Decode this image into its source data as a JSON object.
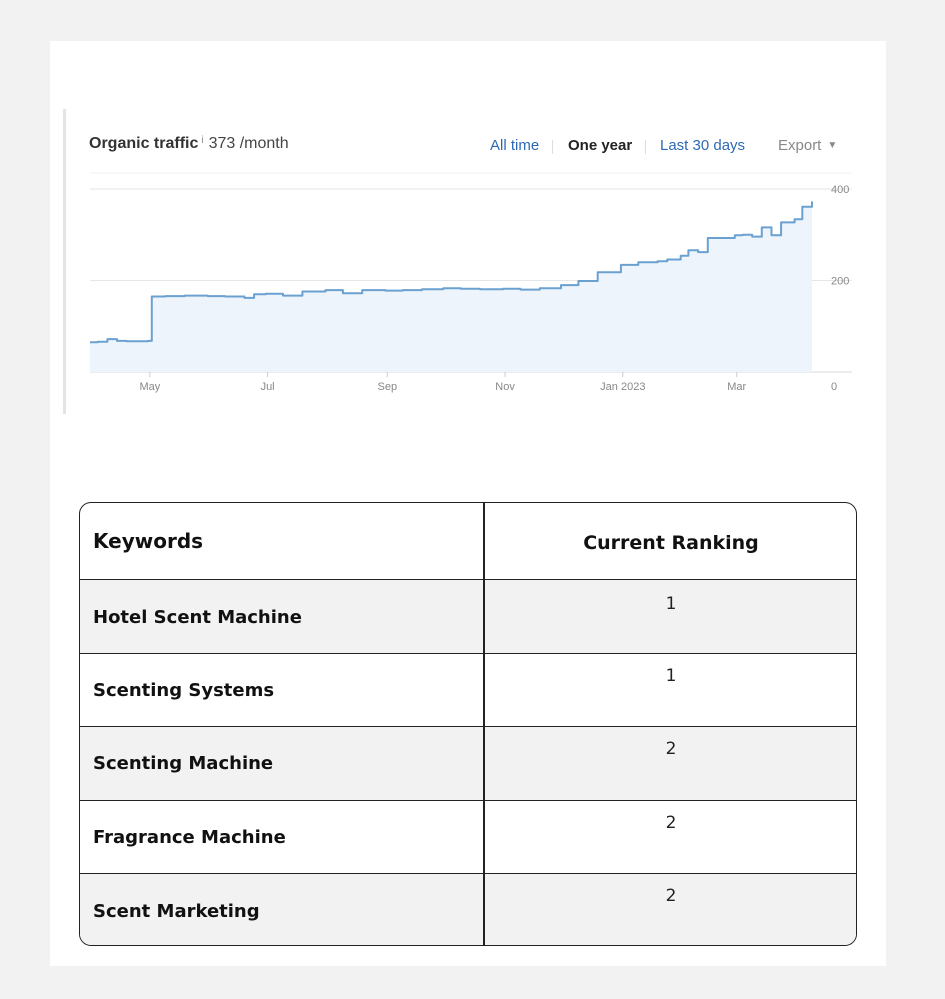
{
  "header": {
    "title": "Organic traffic",
    "info_symbol": "i",
    "value": "373 /month"
  },
  "controls": {
    "ranges": [
      "All time",
      "One year",
      "Last 30 days"
    ],
    "selected_range": "One year",
    "export_label": "Export",
    "export_caret": "▼"
  },
  "chart_data": {
    "type": "area",
    "title": "",
    "xlabel": "",
    "ylabel": "",
    "x_ticks": [
      "May",
      "Jul",
      "Sep",
      "Nov",
      "Jan 2023",
      "Mar"
    ],
    "y_ticks": [
      "400",
      "200",
      "0"
    ],
    "ylim": [
      0,
      400
    ],
    "grid": "horizontal",
    "y_axis_position": "right",
    "series": [
      {
        "x": [
          "Apr 1",
          "Apr 5",
          "Apr 10",
          "Apr 15",
          "Apr 20",
          "Apr 25",
          "May 1",
          "May 3",
          "May 10",
          "May 20",
          "Jun 1",
          "Jun 10",
          "Jun 20",
          "Jun 25",
          "Jul 1",
          "Jul 10",
          "Jul 20",
          "Aug 1",
          "Aug 10",
          "Aug 20",
          "Sep 1",
          "Sep 10",
          "Sep 20",
          "Oct 1",
          "Oct 10",
          "Oct 20",
          "Nov 1",
          "Nov 10",
          "Nov 20",
          "Dec 1",
          "Dec 10",
          "Dec 20",
          "Jan 1",
          "Jan 10",
          "Jan 20",
          "Jan 25",
          "Feb 1",
          "Feb 5",
          "Feb 10",
          "Feb 15",
          "Feb 20",
          "Mar 1",
          "Mar 5",
          "Mar 10",
          "Mar 15",
          "Mar 20",
          "Mar 25",
          "Apr 1",
          "Apr 5",
          "Apr 10"
        ],
        "values": [
          65,
          66,
          72,
          68,
          67,
          67,
          68,
          165,
          166,
          167,
          166,
          165,
          162,
          170,
          171,
          167,
          176,
          179,
          172,
          179,
          178,
          179,
          181,
          183,
          182,
          181,
          182,
          180,
          183,
          190,
          199,
          218,
          234,
          240,
          242,
          246,
          254,
          266,
          262,
          293,
          293,
          299,
          300,
          296,
          316,
          299,
          327,
          334,
          361,
          373
        ]
      }
    ]
  },
  "table": {
    "headers": [
      "Keywords",
      "Current Ranking"
    ],
    "rows": [
      {
        "keyword": "Hotel Scent Machine",
        "ranking": "1"
      },
      {
        "keyword": "Scenting Systems",
        "ranking": "1"
      },
      {
        "keyword": "Scenting Machine",
        "ranking": "2"
      },
      {
        "keyword": "Fragrance Machine",
        "ranking": "2"
      },
      {
        "keyword": "Scent Marketing",
        "ranking": "2"
      }
    ]
  },
  "colors": {
    "line": "#6aa1d0",
    "area_fill": "#eef4fb",
    "grid": "#e6e6e6",
    "link": "#2e6ab4",
    "row_shade": "#f2f2f2"
  }
}
